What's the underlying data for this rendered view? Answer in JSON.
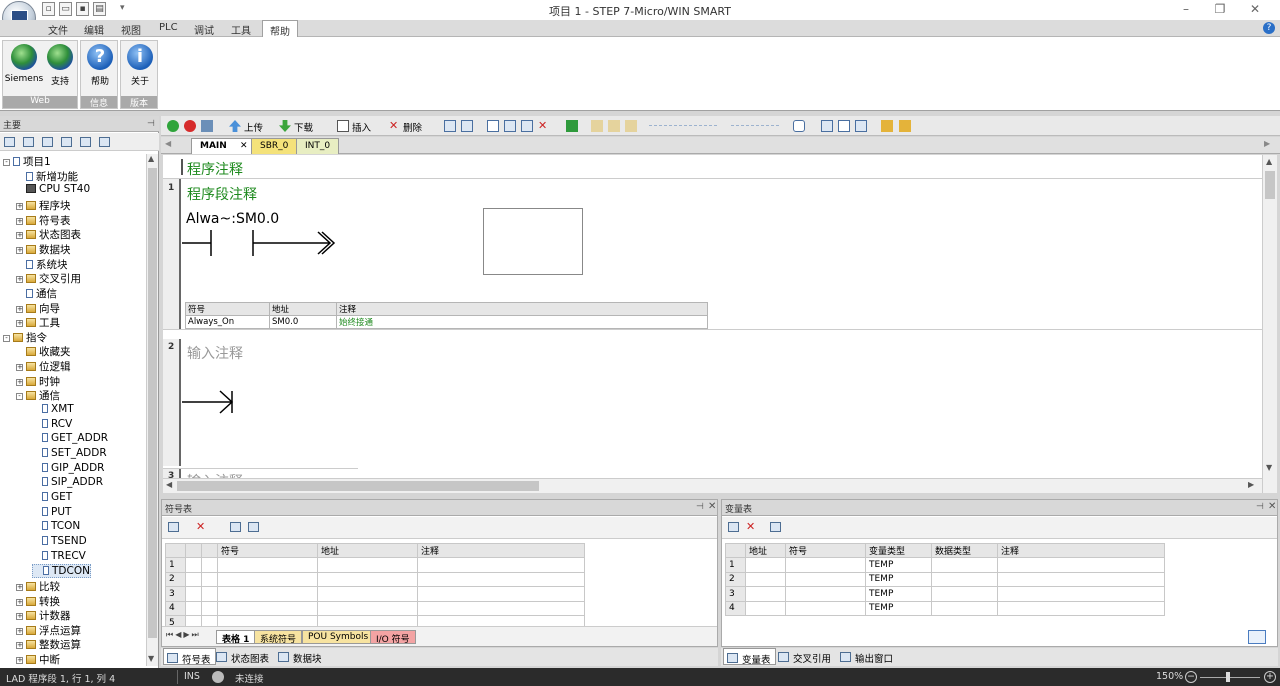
{
  "app": {
    "title": "项目 1 - STEP 7-Micro/WIN SMART"
  },
  "menu": [
    "文件",
    "编辑",
    "视图",
    "PLC",
    "调试",
    "工具",
    "帮助"
  ],
  "ribbon": {
    "groups": [
      {
        "label": "Web",
        "buttons": [
          "Siemens",
          "支持"
        ]
      },
      {
        "label": "信息",
        "buttons": [
          "帮助"
        ]
      },
      {
        "label": "版本",
        "buttons": [
          "关于"
        ]
      }
    ]
  },
  "left_pane": {
    "header": "主要",
    "tree": [
      {
        "label": "项目1",
        "level": 0,
        "expander": "-",
        "icon": "project"
      },
      {
        "label": "新增功能",
        "level": 1,
        "expander": "",
        "icon": "new-feature"
      },
      {
        "label": "CPU ST40",
        "level": 1,
        "expander": "",
        "icon": "cpu"
      },
      {
        "label": "程序块",
        "level": 1,
        "expander": "+",
        "icon": "folder"
      },
      {
        "label": "符号表",
        "level": 1,
        "expander": "+",
        "icon": "folder"
      },
      {
        "label": "状态图表",
        "level": 1,
        "expander": "+",
        "icon": "folder"
      },
      {
        "label": "数据块",
        "level": 1,
        "expander": "+",
        "icon": "folder"
      },
      {
        "label": "系统块",
        "level": 1,
        "expander": "",
        "icon": "doc"
      },
      {
        "label": "交叉引用",
        "level": 1,
        "expander": "+",
        "icon": "folder"
      },
      {
        "label": "通信",
        "level": 1,
        "expander": "",
        "icon": "comm"
      },
      {
        "label": "向导",
        "level": 1,
        "expander": "+",
        "icon": "folder"
      },
      {
        "label": "工具",
        "level": 1,
        "expander": "+",
        "icon": "folder"
      },
      {
        "label": "指令",
        "level": 0,
        "expander": "-",
        "icon": "folder"
      },
      {
        "label": "收藏夹",
        "level": 1,
        "expander": "",
        "icon": "folder"
      },
      {
        "label": "位逻辑",
        "level": 1,
        "expander": "+",
        "icon": "folder"
      },
      {
        "label": "时钟",
        "level": 1,
        "expander": "+",
        "icon": "clock"
      },
      {
        "label": "通信",
        "level": 1,
        "expander": "-",
        "icon": "folder"
      },
      {
        "label": "XMT",
        "level": 2,
        "expander": "",
        "icon": "leaf"
      },
      {
        "label": "RCV",
        "level": 2,
        "expander": "",
        "icon": "leaf"
      },
      {
        "label": "GET_ADDR",
        "level": 2,
        "expander": "",
        "icon": "leaf"
      },
      {
        "label": "SET_ADDR",
        "level": 2,
        "expander": "",
        "icon": "leaf"
      },
      {
        "label": "GIP_ADDR",
        "level": 2,
        "expander": "",
        "icon": "leaf"
      },
      {
        "label": "SIP_ADDR",
        "level": 2,
        "expander": "",
        "icon": "leaf"
      },
      {
        "label": "GET",
        "level": 2,
        "expander": "",
        "icon": "leaf"
      },
      {
        "label": "PUT",
        "level": 2,
        "expander": "",
        "icon": "leaf"
      },
      {
        "label": "TCON",
        "level": 2,
        "expander": "",
        "icon": "leaf"
      },
      {
        "label": "TSEND",
        "level": 2,
        "expander": "",
        "icon": "leaf"
      },
      {
        "label": "TRECV",
        "level": 2,
        "expander": "",
        "icon": "leaf"
      },
      {
        "label": "TDCON",
        "level": 2,
        "expander": "",
        "icon": "leaf",
        "selected": true
      },
      {
        "label": "比较",
        "level": 1,
        "expander": "+",
        "icon": "folder"
      },
      {
        "label": "转换",
        "level": 1,
        "expander": "+",
        "icon": "folder"
      },
      {
        "label": "计数器",
        "level": 1,
        "expander": "+",
        "icon": "folder"
      },
      {
        "label": "浮点运算",
        "level": 1,
        "expander": "+",
        "icon": "folder"
      },
      {
        "label": "整数运算",
        "level": 1,
        "expander": "+",
        "icon": "folder"
      },
      {
        "label": "中断",
        "level": 1,
        "expander": "+",
        "icon": "folder"
      }
    ]
  },
  "toolbar": {
    "upload": "上传",
    "download": "下载",
    "insert": "插入",
    "delete": "删除"
  },
  "editor_tabs": [
    {
      "label": "MAIN",
      "active": true,
      "closable": true
    },
    {
      "label": "SBR_0",
      "active": false
    },
    {
      "label": "INT_0",
      "active": false
    }
  ],
  "editor": {
    "program_comment": "程序注释",
    "networks": [
      {
        "number": "1",
        "comment": "程序段注释",
        "contact": "Alwa~:SM0.0",
        "symbol_table": {
          "headers": [
            "符号",
            "地址",
            "注释"
          ],
          "rows": [
            [
              "Always_On",
              "SM0.0",
              "始终接通"
            ]
          ]
        }
      },
      {
        "number": "2",
        "comment": "输入注释"
      },
      {
        "number": "3",
        "comment": "输入注释"
      }
    ]
  },
  "symbol_pane": {
    "title": "符号表",
    "headers": [
      "符号",
      "地址",
      "注释"
    ],
    "rows": [
      "1",
      "2",
      "3",
      "4",
      "5"
    ],
    "sheet_tabs": [
      "表格 1",
      "系统符号",
      "POU Symbols",
      "I/O 符号"
    ]
  },
  "var_pane": {
    "title": "变量表",
    "headers": [
      "地址",
      "符号",
      "变量类型",
      "数据类型",
      "注释"
    ],
    "rows": [
      {
        "n": "1",
        "type": "TEMP"
      },
      {
        "n": "2",
        "type": "TEMP"
      },
      {
        "n": "3",
        "type": "TEMP"
      },
      {
        "n": "4",
        "type": "TEMP"
      }
    ]
  },
  "bottom_tabs_left": [
    "符号表",
    "状态图表",
    "数据块"
  ],
  "bottom_tabs_right": [
    "变量表",
    "交叉引用",
    "输出窗口"
  ],
  "status": {
    "position": "LAD 程序段 1, 行 1, 列 4",
    "mode": "INS",
    "connection": "未连接",
    "zoom": "150%"
  },
  "colors": {
    "comment_green": "#1e8a1e",
    "tab_sbr": "#f4e27a",
    "tab_int": "#e8eec2",
    "tab_sys": "#f7e3a0",
    "tab_io": "#f3a3a3"
  }
}
